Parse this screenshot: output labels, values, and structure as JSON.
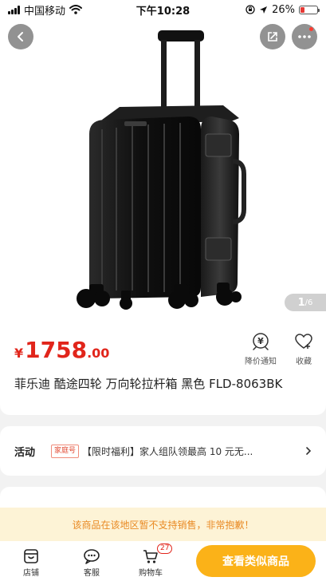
{
  "status_bar": {
    "carrier": "中国移动",
    "time": "下午10:28",
    "battery": "26%",
    "battery_level": 0.26
  },
  "gallery": {
    "current_page": "1",
    "total_pages": "/6"
  },
  "product": {
    "currency": "¥",
    "price_integer": "1758",
    "price_decimal": ".00",
    "title": "菲乐迪 酷途四轮 万向轮拉杆箱 黑色 FLD-8063BK"
  },
  "actions": {
    "price_alert_label": "降价通知",
    "favorite_label": "收藏"
  },
  "promo": {
    "label": "活动",
    "badge": "家庭号",
    "text": "【限时福利】家人组队领最高 10 元无..."
  },
  "notice": {
    "text": "该商品在该地区暂不支持销售，非常抱歉！"
  },
  "bottom_nav": {
    "items": [
      {
        "label": "店铺"
      },
      {
        "label": "客服"
      },
      {
        "label": "购物车"
      }
    ],
    "cart_count": "27",
    "similar_button": "查看类似商品"
  },
  "colors": {
    "price": "#e1251b",
    "cta": "#fbb218",
    "notice_bg": "#fdf3d6",
    "notice_text": "#e98a24"
  }
}
